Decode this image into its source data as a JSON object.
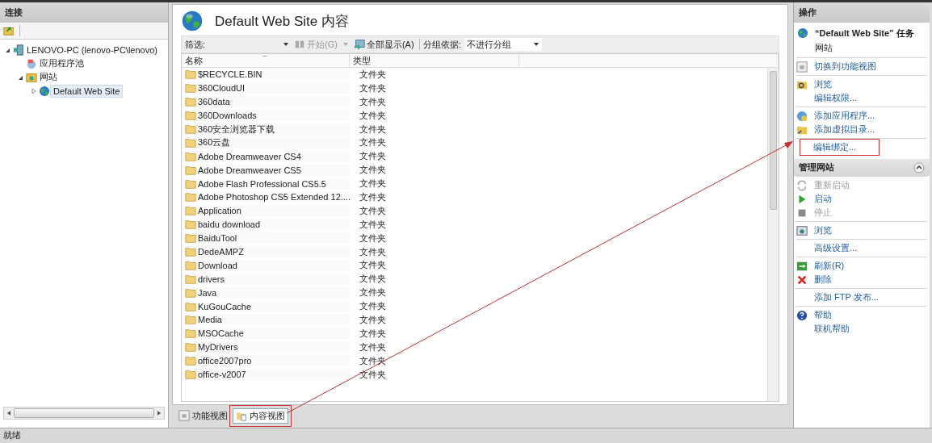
{
  "connections": {
    "title": "连接",
    "tree": [
      {
        "label": "LENOVO-PC (lenovo-PC\\lenovo)",
        "kind": "server",
        "expanded": true,
        "selected": false,
        "children": [
          {
            "label": "应用程序池",
            "kind": "pool",
            "expanded": false,
            "selected": false
          },
          {
            "label": "网站",
            "kind": "sites",
            "expanded": true,
            "selected": false,
            "children": [
              {
                "label": "Default Web Site",
                "kind": "site",
                "expanded": false,
                "selected": true,
                "has_children": true
              }
            ]
          }
        ]
      }
    ]
  },
  "content": {
    "title": "Default Web Site 内容",
    "toolbar": {
      "filter_label": "筛选:",
      "start": {
        "label": "开始(G)",
        "disabled": true
      },
      "show_all": {
        "label": "全部显示(A)",
        "disabled": false
      },
      "group_label": "分组依据:",
      "group_value": "不进行分组"
    },
    "columns": [
      "名称",
      "类型"
    ],
    "rows": [
      {
        "name": "$RECYCLE.BIN",
        "type": "文件夹"
      },
      {
        "name": "360CloudUI",
        "type": "文件夹"
      },
      {
        "name": "360data",
        "type": "文件夹"
      },
      {
        "name": "360Downloads",
        "type": "文件夹"
      },
      {
        "name": "360安全浏览器下载",
        "type": "文件夹"
      },
      {
        "name": "360云盘",
        "type": "文件夹"
      },
      {
        "name": "Adobe Dreamweaver CS4",
        "type": "文件夹"
      },
      {
        "name": "Adobe Dreamweaver CS5",
        "type": "文件夹"
      },
      {
        "name": "Adobe Flash Professional CS5.5",
        "type": "文件夹"
      },
      {
        "name": "Adobe Photoshop CS5 Extended 12....",
        "type": "文件夹"
      },
      {
        "name": "Application",
        "type": "文件夹"
      },
      {
        "name": "baidu download",
        "type": "文件夹"
      },
      {
        "name": "BaiduTool",
        "type": "文件夹"
      },
      {
        "name": "DedeAMPZ",
        "type": "文件夹"
      },
      {
        "name": "Download",
        "type": "文件夹"
      },
      {
        "name": "drivers",
        "type": "文件夹"
      },
      {
        "name": "Java",
        "type": "文件夹"
      },
      {
        "name": "KuGouCache",
        "type": "文件夹"
      },
      {
        "name": "Media",
        "type": "文件夹"
      },
      {
        "name": "MSOCache",
        "type": "文件夹"
      },
      {
        "name": "MyDrivers",
        "type": "文件夹"
      },
      {
        "name": "office2007pro",
        "type": "文件夹"
      },
      {
        "name": "office-v2007",
        "type": "文件夹"
      }
    ],
    "view_tabs": [
      {
        "label": "功能视图",
        "kind": "features",
        "selected": false,
        "highlighted": false
      },
      {
        "label": "内容视图",
        "kind": "content",
        "selected": true,
        "highlighted": true
      }
    ]
  },
  "actions": {
    "title": "操作",
    "task_title": "“Default Web Site” 任务",
    "task_subtitle": "网站",
    "groups": [
      {
        "items": [
          {
            "label": "切换到功能视图",
            "kind": "features",
            "disabled": false,
            "highlighted": false
          }
        ]
      },
      {
        "items": [
          {
            "label": "浏览",
            "kind": "explore",
            "disabled": false,
            "highlighted": false
          },
          {
            "label": "编辑权限...",
            "kind": "plain",
            "disabled": false,
            "highlighted": false
          }
        ]
      },
      {
        "items": [
          {
            "label": "添加应用程序...",
            "kind": "app",
            "disabled": false,
            "highlighted": false
          },
          {
            "label": "添加虚拟目录...",
            "kind": "vdir",
            "disabled": false,
            "highlighted": false
          }
        ]
      },
      {
        "items": [
          {
            "label": "编辑绑定...",
            "kind": "plain",
            "disabled": false,
            "highlighted": true
          }
        ]
      }
    ],
    "section_title": "管理网站",
    "section_expanded": true,
    "section_groups": [
      {
        "items": [
          {
            "label": "重新启动",
            "kind": "restart",
            "disabled": true,
            "highlighted": false
          },
          {
            "label": "启动",
            "kind": "start",
            "disabled": false,
            "highlighted": false
          },
          {
            "label": "停止",
            "kind": "stop",
            "disabled": true,
            "highlighted": false
          }
        ]
      },
      {
        "items": [
          {
            "label": "浏览",
            "kind": "browse",
            "disabled": false,
            "highlighted": false
          }
        ]
      },
      {
        "items": [
          {
            "label": "高级设置...",
            "kind": "plain",
            "disabled": false,
            "highlighted": false
          }
        ]
      },
      {
        "items": [
          {
            "label": "刷新(R)",
            "kind": "refresh",
            "disabled": false,
            "highlighted": false
          },
          {
            "label": "删除",
            "kind": "delete",
            "disabled": false,
            "highlighted": false
          }
        ]
      },
      {
        "items": [
          {
            "label": "添加 FTP 发布...",
            "kind": "plain",
            "disabled": false,
            "highlighted": false
          }
        ]
      },
      {
        "items": [
          {
            "label": "帮助",
            "kind": "help",
            "disabled": false,
            "highlighted": false
          },
          {
            "label": "联机帮助",
            "kind": "plain",
            "disabled": false,
            "highlighted": false
          }
        ]
      }
    ]
  },
  "status_bar": {
    "text": "就绪"
  }
}
